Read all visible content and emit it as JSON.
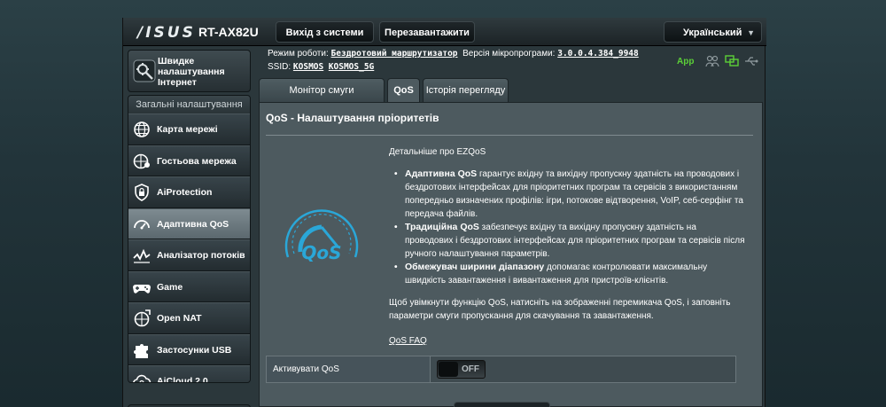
{
  "header": {
    "logo": "/ISUS",
    "model": "RT-AX82U",
    "logout_label": "Вихід з системи",
    "reboot_label": "Перезавантажити",
    "language": "Український"
  },
  "status": {
    "mode_label": "Режим роботи:",
    "mode_value": "Бездротовий маршрутизатор",
    "firmware_label": "Версія мікропрограми:",
    "firmware_value": "3.0.0.4.384_9948",
    "ssid_label": "SSID:",
    "ssid_1": "KOSMOS",
    "ssid_2": "KOSMOS_5G",
    "app_label": "App",
    "icons": [
      "users-icon",
      "network-icon",
      "usb-icon"
    ]
  },
  "sidebar": {
    "quick": {
      "label": "Швидке налаштування Інтернет"
    },
    "general_title": "Загальні налаштування",
    "items": [
      {
        "label": "Карта мережі",
        "icon": "globe-icon",
        "active": false
      },
      {
        "label": "Гостьова мережа",
        "icon": "guest-network-icon",
        "active": false
      },
      {
        "label": "AiProtection",
        "icon": "shield-lock-icon",
        "active": false
      },
      {
        "label": "Адаптивна QoS",
        "icon": "speedometer-icon",
        "active": true
      },
      {
        "label": "Аналізатор потоків",
        "icon": "traffic-analyzer-icon",
        "active": false
      },
      {
        "label": "Game",
        "icon": "gamepad-icon",
        "active": false
      },
      {
        "label": "Open NAT",
        "icon": "open-nat-icon",
        "active": false
      },
      {
        "label": "Застосунки USB",
        "icon": "puzzle-icon",
        "active": false
      },
      {
        "label": "AiCloud 2.0",
        "icon": "cloud-icon",
        "active": false
      }
    ]
  },
  "tabs": [
    {
      "label": "Монітор смуги пропускання",
      "active": false
    },
    {
      "label": "QoS",
      "active": true
    },
    {
      "label": "Історія перегляду",
      "active": false
    }
  ],
  "content": {
    "title": "QoS - Налаштування пріоритетів",
    "logo_text": "QoS",
    "about": "Детальніше про EZQoS",
    "bullets": [
      {
        "bold": "Адаптивна QoS",
        "text": " гарантує вхідну та вихідну пропускну здатність на проводових і бездротових інтерфейсах для пріоритетних програм та сервісів з використанням попередньо визначених профілів: ігри, потокове відтворення, VoIP, себ-серфінг та передача файлів."
      },
      {
        "bold": "Традиційна QoS",
        "text": " забезпечує вхідну та вихідну пропускну здатність на проводових і бездротових інтерфейсах для пріоритетних програм та сервісів після ручного налаштування параметрів."
      },
      {
        "bold": "Обмежувач ширини діапазону",
        "text": " допомагає контролювати максимальну швидкість завантаження і вивантаження для пристроїв-клієнтів."
      }
    ],
    "hint": "Щоб увімкнути функцію QoS, натисніть на зображенні перемикача QoS, і заповніть параметри смуги пропускання для скачування та завантаження.",
    "faq": "QoS FAQ",
    "activate_label": "Активувати QoS",
    "toggle_state": "OFF"
  },
  "colors": {
    "accent_green": "#5cd038",
    "qos_blue": "#2aa7d8",
    "active_menu": "#6e7b81"
  }
}
